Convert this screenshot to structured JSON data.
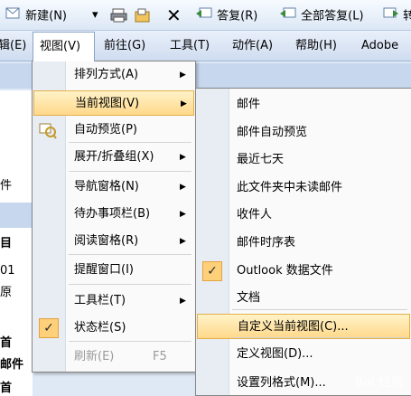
{
  "toolbar": {
    "new_label": "新建(N)",
    "reply_label": "答复(R)",
    "reply_all_label": "全部答复(L)",
    "forward_partial": "转"
  },
  "menubar": {
    "edit_partial": "辑(E)",
    "view": "视图(V)",
    "go": "前往(G)",
    "tools": "工具(T)",
    "actions": "动作(A)",
    "help": "帮助(H)",
    "adobe": "Adobe"
  },
  "left_pane": {
    "lines": [
      "件",
      "目",
      "01",
      "原",
      "首",
      "邮件",
      "首"
    ]
  },
  "view_menu": {
    "items": [
      {
        "label": "排列方式(A)",
        "submenu": true
      },
      {
        "label": "当前视图(V)",
        "submenu": true,
        "highlighted": true
      },
      {
        "label": "自动预览(P)",
        "icon": "autopreview-icon"
      },
      {
        "label": "展开/折叠组(X)",
        "submenu": true
      },
      {
        "label": "导航窗格(N)",
        "submenu": true
      },
      {
        "label": "待办事项栏(B)",
        "submenu": true
      },
      {
        "label": "阅读窗格(R)",
        "submenu": true
      },
      {
        "label": "提醒窗口(I)"
      },
      {
        "label": "工具栏(T)",
        "submenu": true
      },
      {
        "label": "状态栏(S)",
        "checked": true
      },
      {
        "label": "刷新(E)",
        "shortcut": "F5",
        "disabled": true
      }
    ]
  },
  "current_view_menu": {
    "items": [
      {
        "label": "邮件"
      },
      {
        "label": "邮件自动预览"
      },
      {
        "label": "最近七天"
      },
      {
        "label": "此文件夹中未读邮件"
      },
      {
        "label": "收件人"
      },
      {
        "label": "邮件时序表"
      },
      {
        "label": "Outlook 数据文件",
        "checked": true
      },
      {
        "label": "文档"
      },
      {
        "label": "自定义当前视图(C)...",
        "highlighted": true
      },
      {
        "label": "定义视图(D)..."
      },
      {
        "label": "设置列格式(M)..."
      }
    ]
  },
  "watermark": "Bai 经验"
}
